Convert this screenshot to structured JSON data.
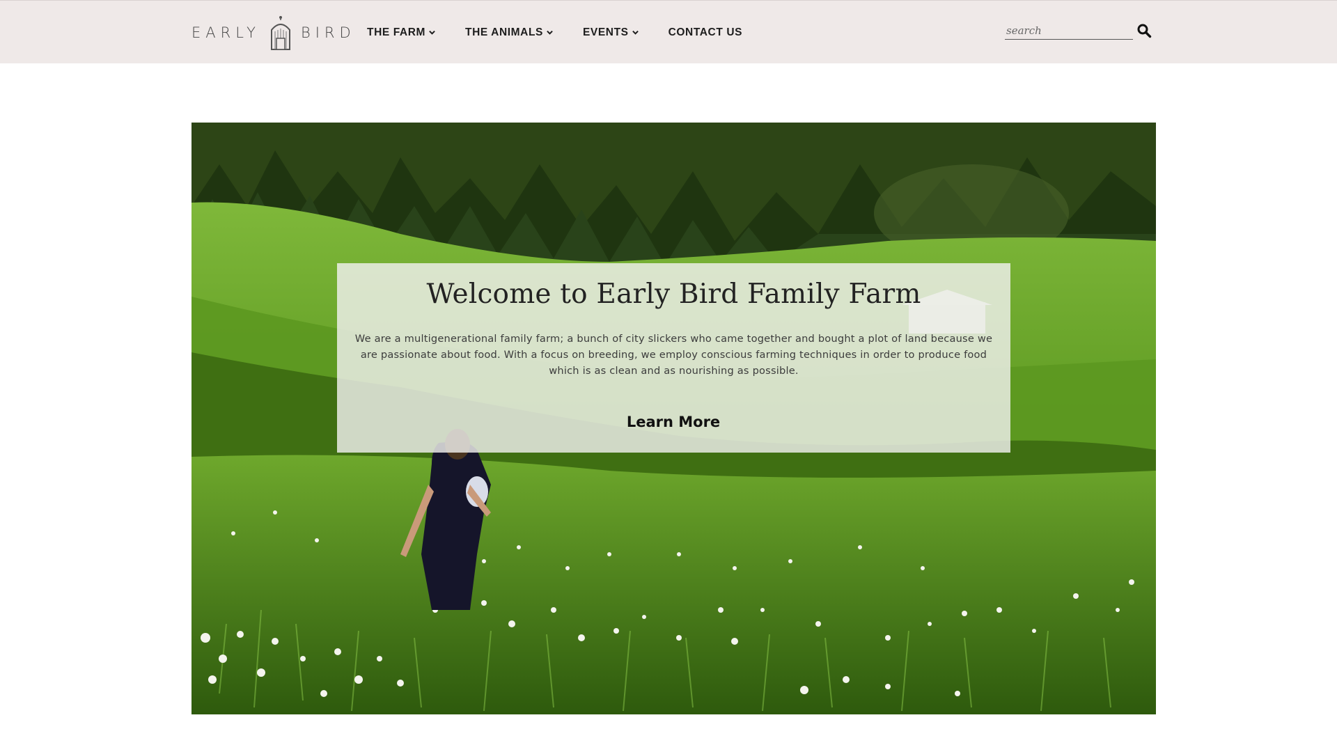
{
  "header": {
    "logo_left": "EARLY",
    "logo_right": "BIRD",
    "nav": [
      {
        "label": "THE FARM",
        "has_dropdown": true
      },
      {
        "label": "THE ANIMALS",
        "has_dropdown": true
      },
      {
        "label": "EVENTS",
        "has_dropdown": true
      },
      {
        "label": "CONTACT US",
        "has_dropdown": false
      }
    ],
    "search": {
      "placeholder": "search",
      "value": "",
      "icon": "search-icon"
    }
  },
  "hero": {
    "title": "Welcome to Early Bird Family Farm",
    "description": "We are a multigenerational family farm; a bunch of city slickers who came together and bought a plot of land because we are passionate about food. With a focus on breeding, we employ conscious farming techniques in order to produce food which is as clean and as nourishing as possible.",
    "cta": "Learn More"
  },
  "colors": {
    "header_bg": "#efe9e8",
    "overlay_bg": "rgba(240,240,238,0.82)",
    "text_dark": "#1d1d1d"
  }
}
